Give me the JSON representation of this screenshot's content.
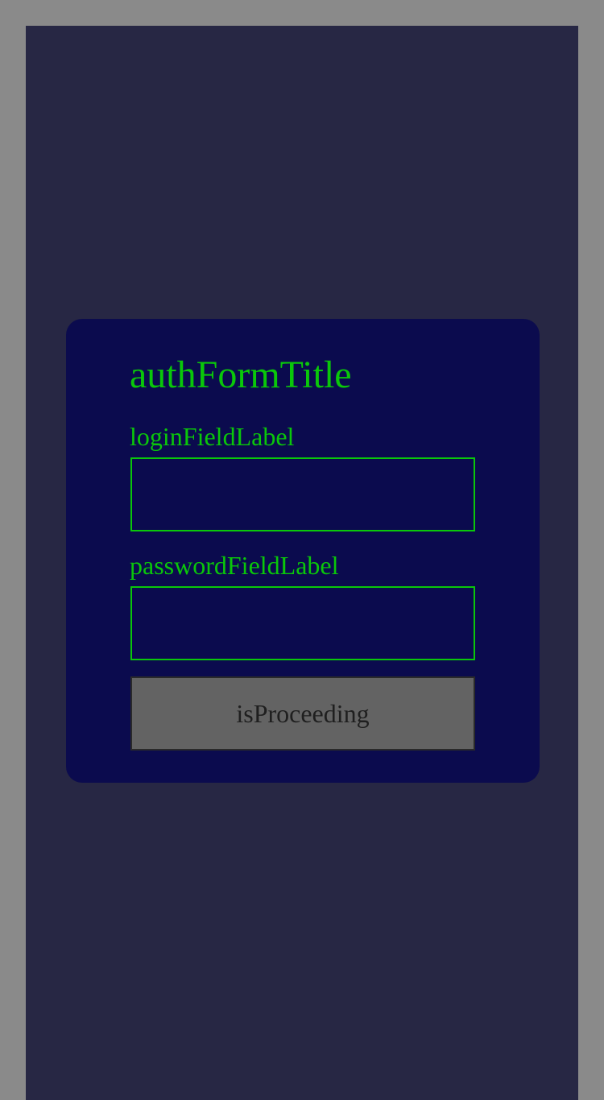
{
  "auth_form": {
    "title": "authFormTitle",
    "login": {
      "label": "loginFieldLabel",
      "value": "",
      "placeholder": ""
    },
    "password": {
      "label": "passwordFieldLabel",
      "value": "",
      "placeholder": ""
    },
    "submit_label": "isProceeding"
  },
  "colors": {
    "page_background": "#8a8a8a",
    "app_background": "#272744",
    "card_background": "#0b0b4e",
    "accent_green": "#0ac70a",
    "button_background": "#636363",
    "button_text": "#1f1f1f"
  }
}
